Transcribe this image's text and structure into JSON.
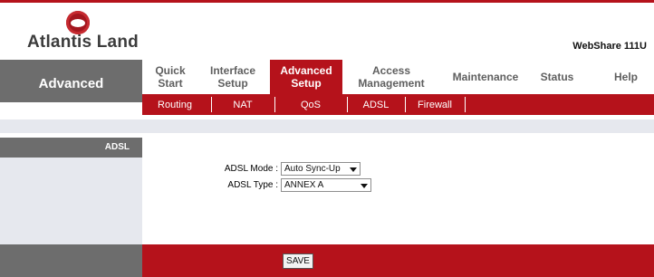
{
  "brand": {
    "logo_text": "Atlantis Land",
    "model": "WebShare 111U"
  },
  "nav": {
    "section_title": "Advanced",
    "tabs": [
      {
        "label": "Quick\nStart",
        "active": false
      },
      {
        "label": "Interface\nSetup",
        "active": false
      },
      {
        "label": "Advanced\nSetup",
        "active": true
      },
      {
        "label": "Access\nManagement",
        "active": false
      },
      {
        "label": "Maintenance",
        "active": false
      },
      {
        "label": "Status",
        "active": false
      },
      {
        "label": "Help",
        "active": false
      }
    ],
    "subtabs": [
      "Routing",
      "NAT",
      "QoS",
      "ADSL",
      "Firewall"
    ]
  },
  "sidebar": {
    "heading": "ADSL"
  },
  "form": {
    "mode_label": "ADSL Mode :",
    "mode_value": "Auto Sync-Up",
    "type_label": "ADSL Type :",
    "type_value": "ANNEX A"
  },
  "footer": {
    "save_label": "SAVE"
  },
  "colors": {
    "accent": "#b5121b",
    "gray": "#6d6d6d",
    "light": "#e6e8ee"
  },
  "icons": {
    "logo": "atlantis-logo-icon",
    "dropdown": "chevron-down-icon"
  }
}
